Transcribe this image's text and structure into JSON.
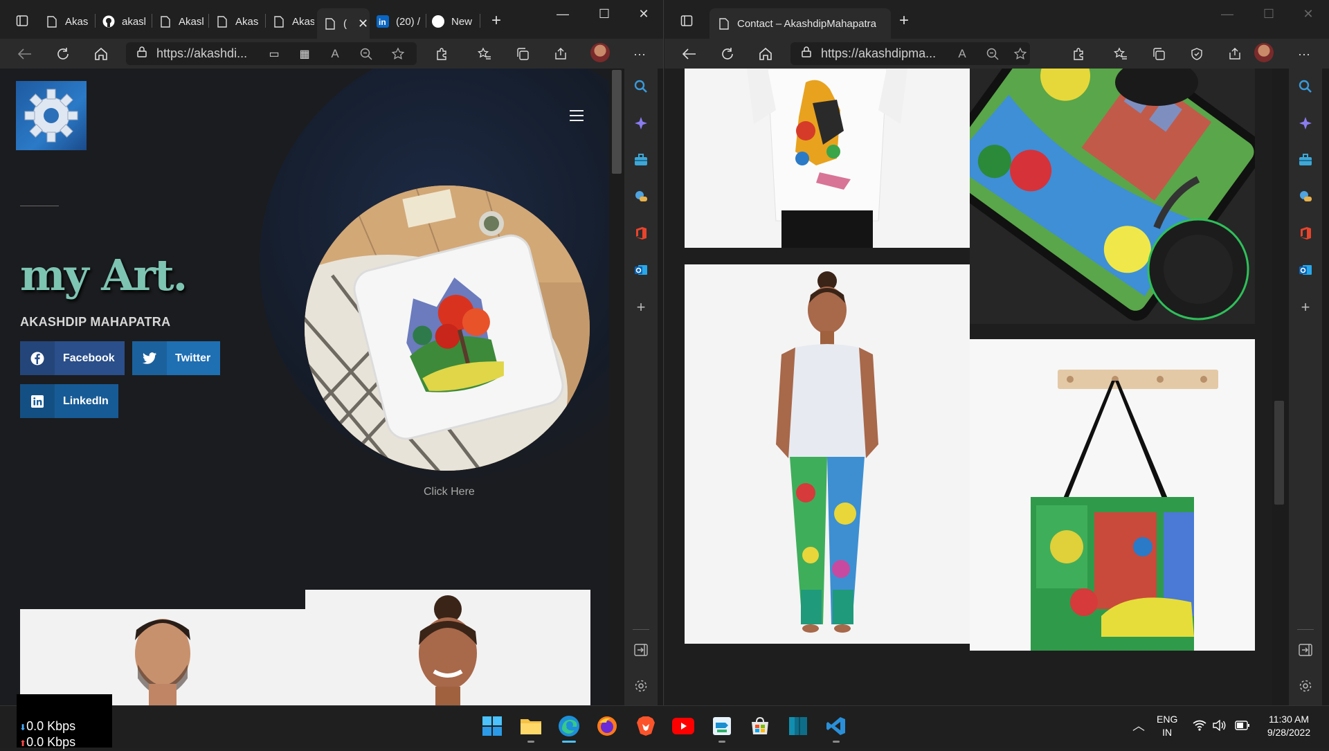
{
  "left_window": {
    "tabs": [
      {
        "label": "Akas",
        "icon": "page-icon"
      },
      {
        "label": "akasl",
        "icon": "github-icon"
      },
      {
        "label": "Akasl",
        "icon": "page-icon"
      },
      {
        "label": "Akas",
        "icon": "page-icon"
      },
      {
        "label": "Akas",
        "icon": "page-icon"
      },
      {
        "label": "(",
        "icon": "page-icon"
      },
      {
        "label": "(20) /",
        "icon": "linkedin-icon"
      },
      {
        "label": "New",
        "icon": "circle-icon"
      }
    ],
    "address": "https://akashdi...",
    "page": {
      "title": "my Art.",
      "subtitle": "AKASHDIP MAHAPATRA",
      "buttons": {
        "facebook": "Facebook",
        "twitter": "Twitter",
        "linkedin": "LinkedIn"
      },
      "click_here": "Click Here"
    }
  },
  "right_window": {
    "tab_title": "Contact – AkashdipMahapatra",
    "address": "https://akashdipma..."
  },
  "taskbar": {
    "net_down": "0.0 Kbps",
    "net_up": "0.0 Kbps",
    "lang1": "ENG",
    "lang2": "IN",
    "time": "11:30 AM",
    "date": "9/28/2022"
  },
  "colors": {
    "accent_teal": "#7ec4b3",
    "facebook": "#2a4f8a",
    "twitter": "#1f6fb3",
    "linkedin": "#175b96",
    "page_bg": "#1b1c1f"
  }
}
